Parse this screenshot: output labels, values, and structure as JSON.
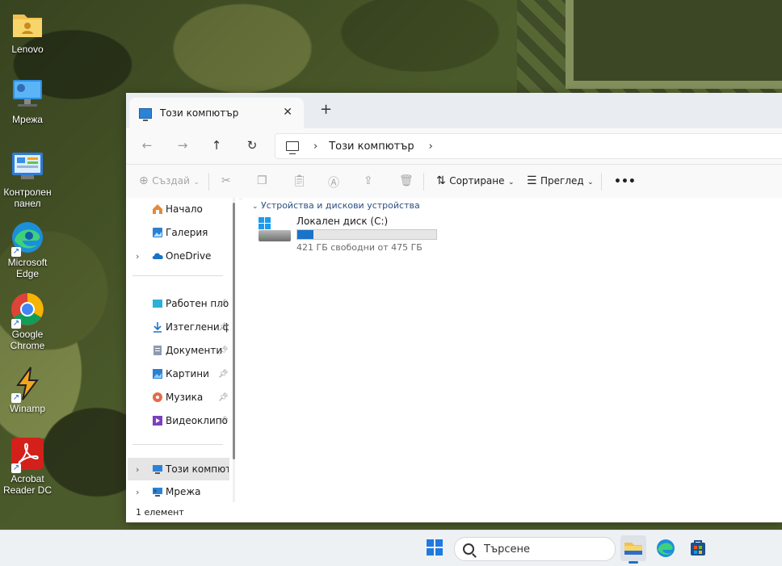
{
  "desktop": {
    "icons": [
      {
        "label": "Lenovo",
        "icon": "folder-user-icon"
      },
      {
        "label": "Мрежа",
        "icon": "network-icon"
      },
      {
        "label": "Контролен панел",
        "icon": "control-panel-icon"
      },
      {
        "label": "Microsoft Edge",
        "icon": "edge-icon"
      },
      {
        "label": "Google Chrome",
        "icon": "chrome-icon"
      },
      {
        "label": "Winamp",
        "icon": "winamp-icon"
      },
      {
        "label": "Acrobat Reader DC",
        "icon": "acrobat-icon"
      }
    ]
  },
  "window": {
    "tab_title": "Този компютър",
    "tab_close": "✕",
    "new_tab": "+",
    "address": {
      "separator1": "›",
      "location": "Този компютър",
      "separator2": "›"
    },
    "toolbar": {
      "new_label": "Създай",
      "sort_label": "Сортиране",
      "view_label": "Преглед",
      "more": "•••"
    },
    "sidebar": {
      "home": "Начало",
      "gallery": "Галерия",
      "onedrive": "OneDrive",
      "pinned": [
        {
          "label": "Работен плот",
          "icon": "desktop-icon"
        },
        {
          "label": "Изтеглени файлове",
          "icon": "download-icon"
        },
        {
          "label": "Документи",
          "icon": "documents-icon"
        },
        {
          "label": "Картини",
          "icon": "pictures-icon"
        },
        {
          "label": "Музика",
          "icon": "music-icon"
        },
        {
          "label": "Видеоклипове",
          "icon": "videos-icon"
        }
      ],
      "this_pc": "Този компютър",
      "network": "Мрежа"
    },
    "content": {
      "group_header": "Устройства и дискови устройства",
      "drive": {
        "name": "Локален диск (C:)",
        "info": "421 ГБ свободни от 475 ГБ",
        "used_fraction": 0.114
      }
    },
    "status": "1 елемент"
  },
  "taskbar": {
    "search_placeholder": "Търсене"
  },
  "colors": {
    "accent": "#1a73c9",
    "group_header": "#2b4f81"
  }
}
